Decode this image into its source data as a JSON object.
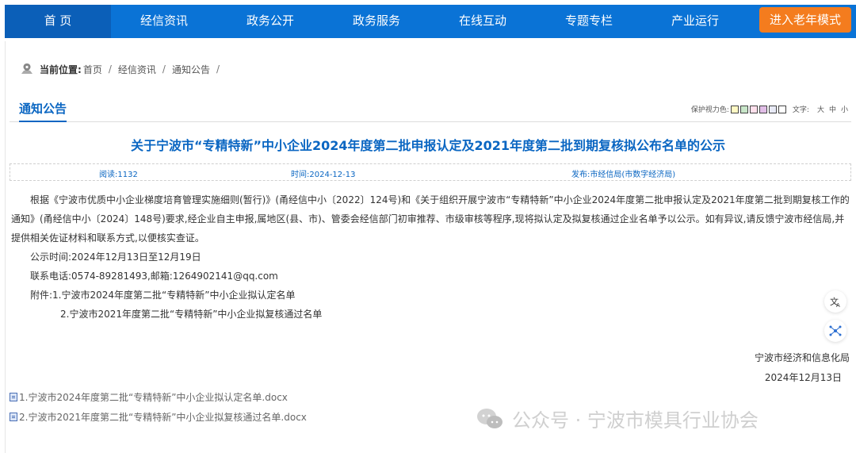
{
  "nav": {
    "items": [
      "首 页",
      "经信资讯",
      "政务公开",
      "政务服务",
      "在线互动",
      "专题专栏",
      "产业运行"
    ],
    "active_index": 0,
    "elder_mode": "进入老年模式"
  },
  "breadcrumb": {
    "label": "当前位置:",
    "items": [
      "首页",
      "经信资讯",
      "通知公告"
    ]
  },
  "section": {
    "title": "通知公告",
    "eye_label": "保护视力色:",
    "swatches": [
      "#fff9c4",
      "#c8e6c9",
      "#ffe0ec",
      "#e1bee7",
      "#e8eaf6",
      "#ffffff"
    ],
    "font_label": "文字:",
    "sizes": [
      "大",
      "中",
      "小"
    ]
  },
  "article": {
    "title": "关于宁波市“专精特新”中小企业2024年度第二批申报认定及2021年度第二批到期复核拟公布名单的公示",
    "reads": "阅读:1132",
    "time": "时间:2024-12-13",
    "publisher": "发布:市经信局(市数字经济局)",
    "body": "根据《宁波市优质中小企业梯度培育管理实施细则(暂行)》(甬经信中小〔2022〕124号)和《关于组织开展宁波市“专精特新”中小企业2024年度第二批申报认定及2021年度第二批到期复核工作的通知》(甬经信中小〔2024〕148号)要求,经企业自主申报,属地区(县、市)、管委会经信部门初审推荐、市级审核等程序,现将拟认定及拟复核通过企业名单予以公示。如有异议,请反馈宁波市经信局,并提供相关佐证材料和联系方式,以便核实查证。",
    "notice_period": "公示时间:2024年12月13日至12月19日",
    "contact": "联系电话:0574-89281493,邮箱:1264902141@qq.com",
    "attachment_1": "附件:1.宁波市2024年度第二批“专精特新”中小企业拟认定名单",
    "attachment_2": "2.宁波市2021年度第二批“专精特新”中小企业拟复核通过名单",
    "signer": "宁波市经济和信息化局",
    "date": "2024年12月13日"
  },
  "files": [
    "1.宁波市2024年度第二批“专精特新”中小企业拟认定名单.docx",
    "2.宁波市2021年度第二批“专精特新”中小企业拟复核通过名单.docx"
  ],
  "watermark": "公众号 · 宁波市模具行业协会",
  "side_buttons": [
    "accessibility-icon",
    "network-icon"
  ]
}
